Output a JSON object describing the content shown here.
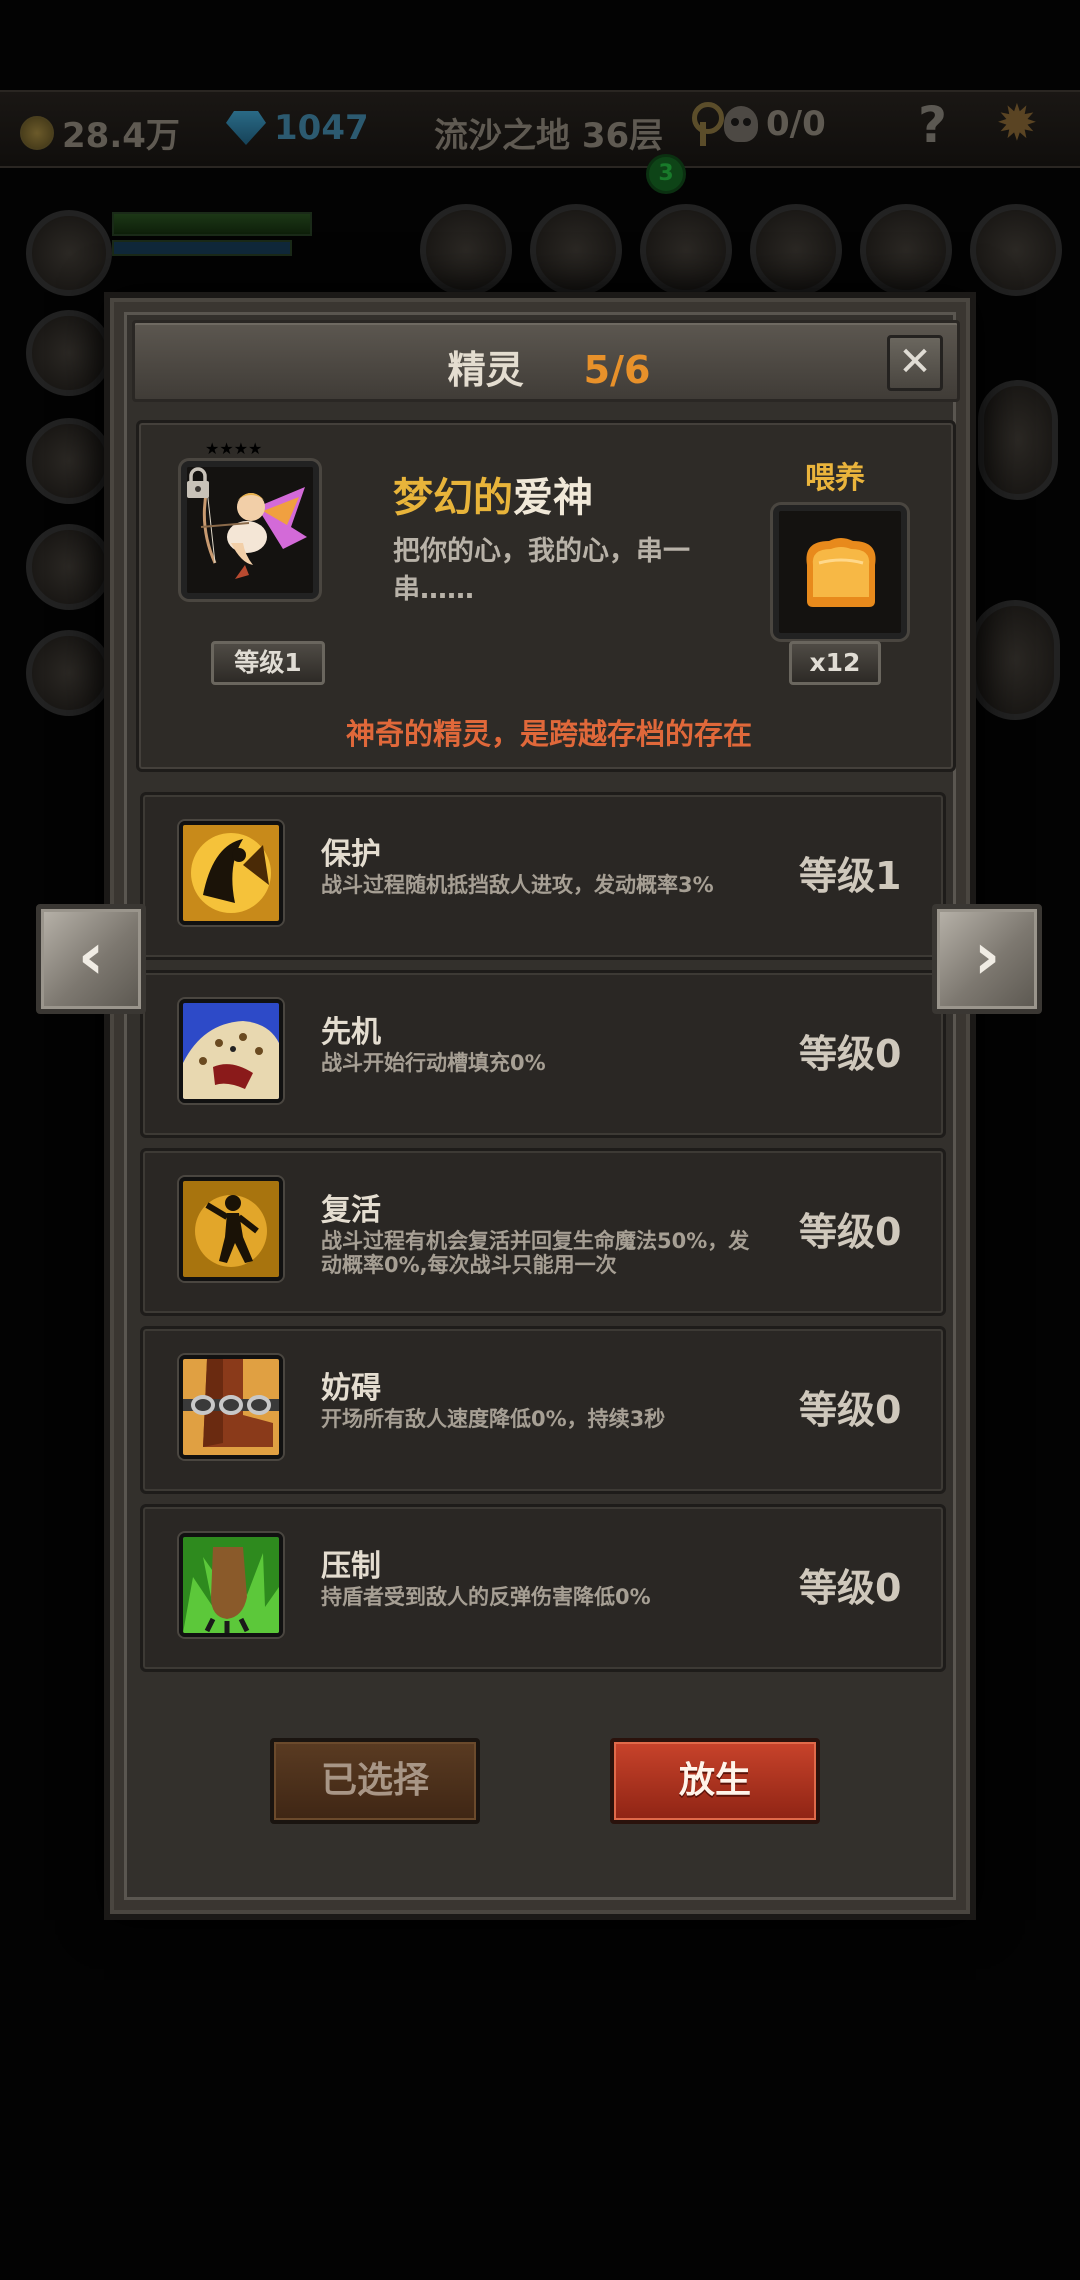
{
  "topbar": {
    "gold": "28.4万",
    "gems": "1047",
    "location": "流沙之地 36层",
    "keys": "0/0",
    "help": "?",
    "badge_count": "3"
  },
  "dialog": {
    "title": "精灵",
    "count": "5/6",
    "close": "✕"
  },
  "pet": {
    "stars": "★★★★",
    "level": "等级1",
    "name_prefix": "梦幻的",
    "name_suffix": "爱神",
    "description": "把你的心，我的心，串一串……",
    "feed_label": "喂养",
    "feed_count": "x12",
    "note": "神奇的精灵，是跨越存档的存在"
  },
  "skills": [
    {
      "name": "保护",
      "desc": "战斗过程随机抵挡敌人进攻，发动概率3%",
      "level": "等级1"
    },
    {
      "name": "先机",
      "desc": "战斗开始行动槽填充0%",
      "level": "等级0"
    },
    {
      "name": "复活",
      "desc": "战斗过程有机会复活并回复生命魔法50%，发动概率0%,每次战斗只能用一次",
      "level": "等级0"
    },
    {
      "name": "妨碍",
      "desc": "开场所有敌人速度降低0%，持续3秒",
      "level": "等级0"
    },
    {
      "name": "压制",
      "desc": "持盾者受到敌人的反弹伤害降低0%",
      "level": "等级0"
    }
  ],
  "buttons": {
    "selected": "已选择",
    "release": "放生"
  },
  "nav": {
    "prev": "‹",
    "next": "›"
  },
  "colors": {
    "title_count": "#e8912a",
    "pet_name_prefix": "#e8b43a",
    "note": "#e0683a",
    "release_button": "#c8432b"
  }
}
